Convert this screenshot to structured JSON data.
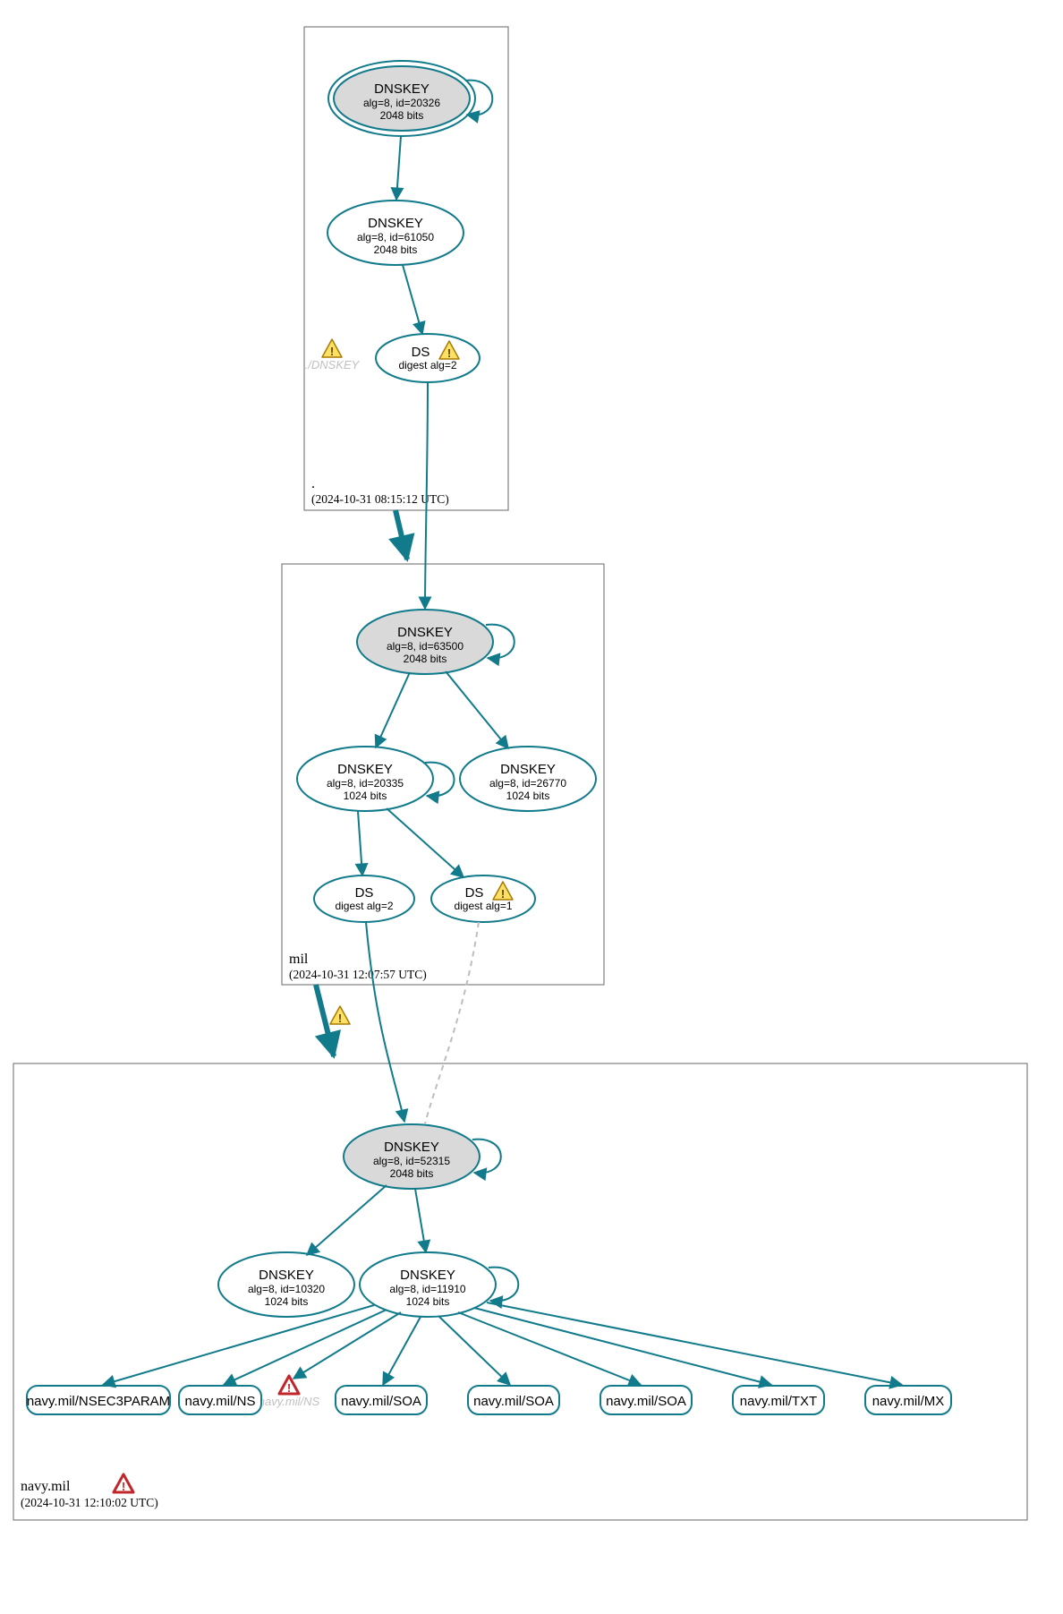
{
  "zones": {
    "root": {
      "label": ".",
      "timestamp": "(2024-10-31 08:15:12 UTC)"
    },
    "mil": {
      "label": "mil",
      "timestamp": "(2024-10-31 12:07:57 UTC)"
    },
    "navy": {
      "label": "navy.mil",
      "timestamp": "(2024-10-31 12:10:02 UTC)"
    }
  },
  "nodes": {
    "root_ksk": {
      "title": "DNSKEY",
      "line2": "alg=8, id=20326",
      "line3": "2048 bits"
    },
    "root_zsk": {
      "title": "DNSKEY",
      "line2": "alg=8, id=61050",
      "line3": "2048 bits"
    },
    "root_ghost": {
      "label": "./DNSKEY"
    },
    "mil_ds": {
      "title": "DS",
      "line2": "digest alg=2"
    },
    "mil_ksk": {
      "title": "DNSKEY",
      "line2": "alg=8, id=63500",
      "line3": "2048 bits"
    },
    "mil_zsk1": {
      "title": "DNSKEY",
      "line2": "alg=8, id=20335",
      "line3": "1024 bits"
    },
    "mil_zsk2": {
      "title": "DNSKEY",
      "line2": "alg=8, id=26770",
      "line3": "1024 bits"
    },
    "navy_ds2": {
      "title": "DS",
      "line2": "digest alg=2"
    },
    "navy_ds1": {
      "title": "DS",
      "line2": "digest alg=1"
    },
    "navy_ksk": {
      "title": "DNSKEY",
      "line2": "alg=8, id=52315",
      "line3": "2048 bits"
    },
    "navy_zsk1": {
      "title": "DNSKEY",
      "line2": "alg=8, id=10320",
      "line3": "1024 bits"
    },
    "navy_zsk2": {
      "title": "DNSKEY",
      "line2": "alg=8, id=11910",
      "line3": "1024 bits"
    },
    "navy_ghost": {
      "label": "navy.mil/NS"
    }
  },
  "rrsets": {
    "r0": "navy.mil/NSEC3PARAM",
    "r1": "navy.mil/NS",
    "r2": "navy.mil/SOA",
    "r3": "navy.mil/SOA",
    "r4": "navy.mil/SOA",
    "r5": "navy.mil/TXT",
    "r6": "navy.mil/MX"
  },
  "colors": {
    "accent": "#117a8b",
    "ghost_text": "#c0c0c0"
  }
}
